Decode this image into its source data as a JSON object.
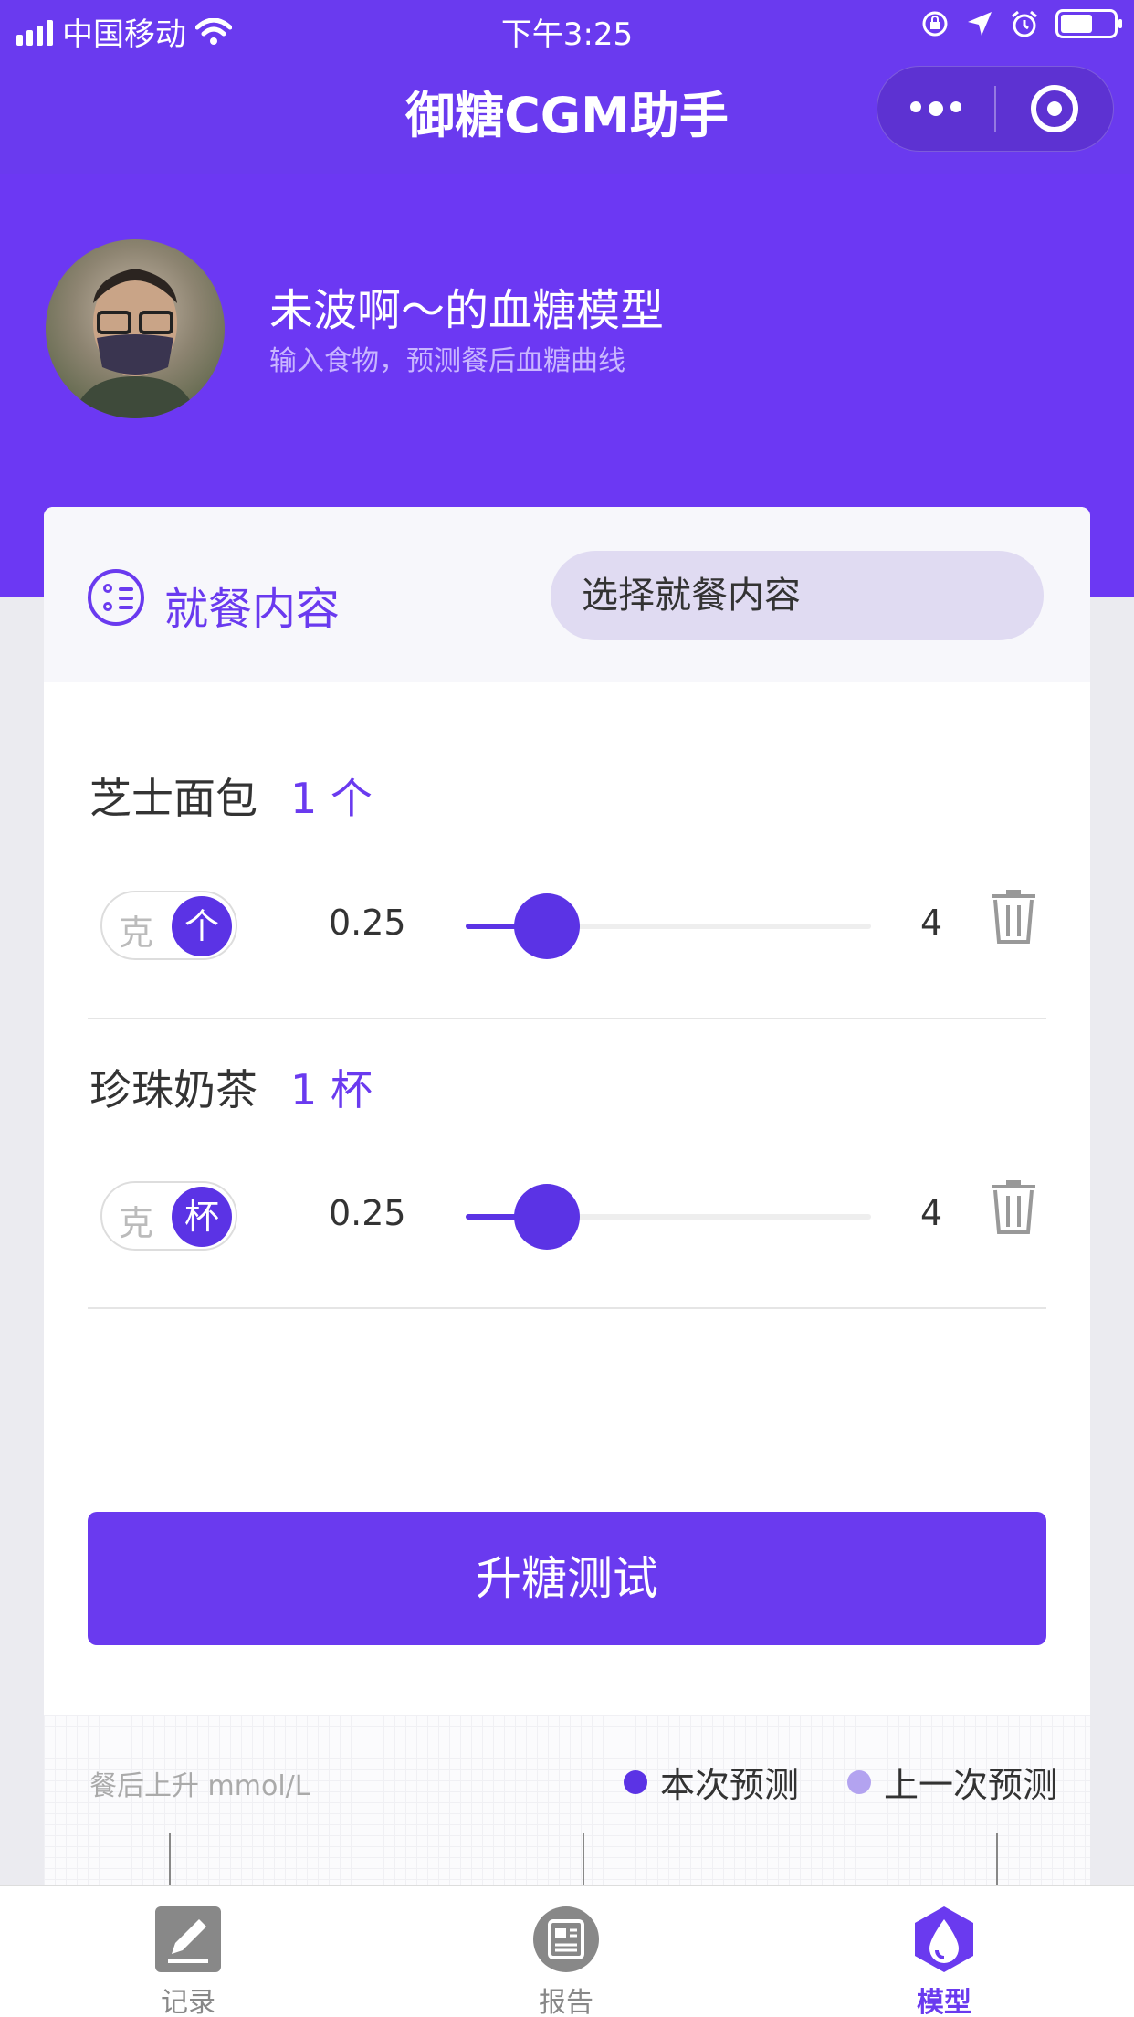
{
  "status_bar": {
    "carrier": "中国移动",
    "time": "下午3:25"
  },
  "nav": {
    "title": "御糖CGM助手"
  },
  "profile": {
    "title": "未波啊～的血糖模型",
    "subtitle": "输入食物，预测餐后血糖曲线"
  },
  "meal": {
    "label": "就餐内容",
    "select_button": "选择就餐内容"
  },
  "foods": [
    {
      "name": "芝士面包",
      "qty": "1 个",
      "unit_off": "克",
      "unit_on": "个",
      "min": "0.25",
      "max": "4",
      "value": 1
    },
    {
      "name": "珍珠奶茶",
      "qty": "1 杯",
      "unit_off": "克",
      "unit_on": "杯",
      "min": "0.25",
      "max": "4",
      "value": 1
    }
  ],
  "test_button": "升糖测试",
  "chart": {
    "ylabel": "餐后上升 mmol/L",
    "legend_current": "本次预测",
    "legend_previous": "上一次预测",
    "color_current": "#5b33e5",
    "color_previous": "#b3a3f0"
  },
  "tabs": [
    {
      "label": "记录",
      "icon": "pencil-square-icon",
      "active": false
    },
    {
      "label": "报告",
      "icon": "report-icon",
      "active": false
    },
    {
      "label": "模型",
      "icon": "droplet-hexagon-icon",
      "active": true
    }
  ]
}
